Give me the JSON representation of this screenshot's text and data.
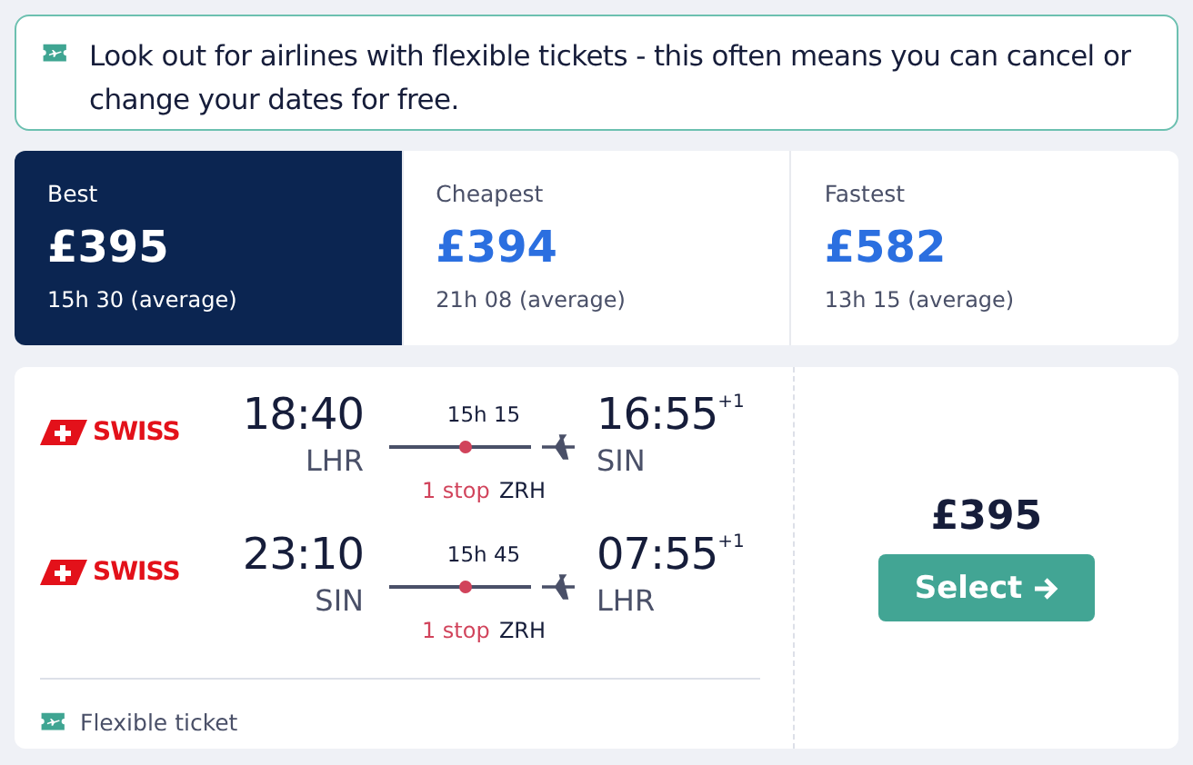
{
  "banner": {
    "text": "Look out for airlines with flexible tickets - this often means you can cancel or change your dates for free."
  },
  "sort_tabs": [
    {
      "label": "Best",
      "price": "£395",
      "duration": "15h 30 (average)",
      "selected": true
    },
    {
      "label": "Cheapest",
      "price": "£394",
      "duration": "21h 08 (average)",
      "selected": false
    },
    {
      "label": "Fastest",
      "price": "£582",
      "duration": "13h 15 (average)",
      "selected": false
    }
  ],
  "result": {
    "legs": [
      {
        "airline": "SWISS",
        "depart_time": "18:40",
        "depart_airport": "LHR",
        "duration": "15h 15",
        "stops": "1 stop",
        "via": "ZRH",
        "arrive_time": "16:55",
        "day_offset": "+1",
        "arrive_airport": "SIN"
      },
      {
        "airline": "SWISS",
        "depart_time": "23:10",
        "depart_airport": "SIN",
        "duration": "15h 45",
        "stops": "1 stop",
        "via": "ZRH",
        "arrive_time": "07:55",
        "day_offset": "+1",
        "arrive_airport": "LHR"
      }
    ],
    "badge": "Flexible ticket",
    "price": "£395",
    "button": "Select"
  }
}
